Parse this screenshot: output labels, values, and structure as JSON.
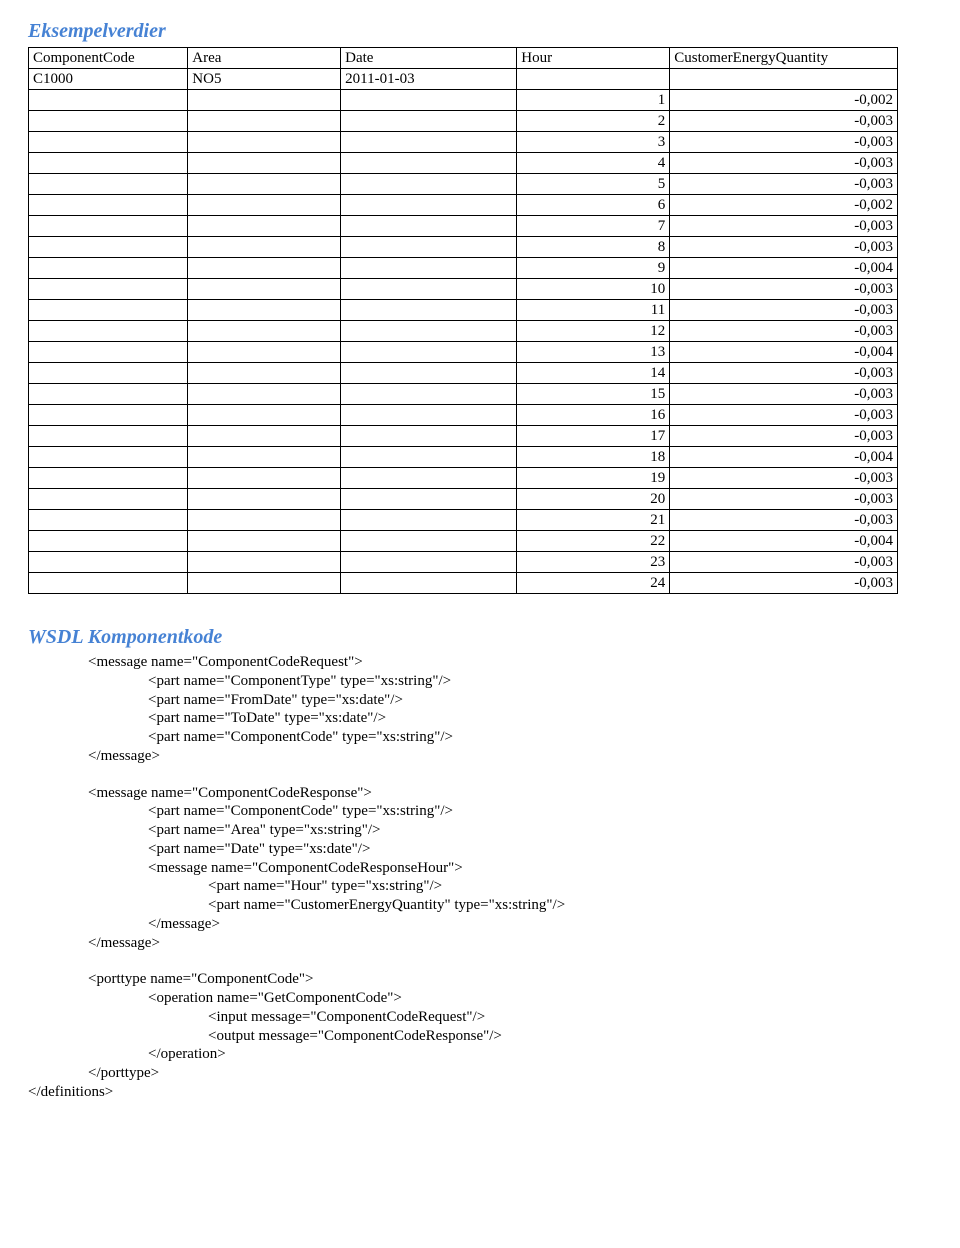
{
  "heading1": "Eksempelverdier",
  "table": {
    "headers": [
      "ComponentCode",
      "Area",
      "Date",
      "Hour",
      "CustomerEnergyQuantity"
    ],
    "first_row": {
      "code": "C1000",
      "area": "NO5",
      "date": "2011-01-03",
      "hour": "",
      "qty": ""
    },
    "rows": [
      {
        "hour": "1",
        "qty": "-0,002"
      },
      {
        "hour": "2",
        "qty": "-0,003"
      },
      {
        "hour": "3",
        "qty": "-0,003"
      },
      {
        "hour": "4",
        "qty": "-0,003"
      },
      {
        "hour": "5",
        "qty": "-0,003"
      },
      {
        "hour": "6",
        "qty": "-0,002"
      },
      {
        "hour": "7",
        "qty": "-0,003"
      },
      {
        "hour": "8",
        "qty": "-0,003"
      },
      {
        "hour": "9",
        "qty": "-0,004"
      },
      {
        "hour": "10",
        "qty": "-0,003"
      },
      {
        "hour": "11",
        "qty": "-0,003"
      },
      {
        "hour": "12",
        "qty": "-0,003"
      },
      {
        "hour": "13",
        "qty": "-0,004"
      },
      {
        "hour": "14",
        "qty": "-0,003"
      },
      {
        "hour": "15",
        "qty": "-0,003"
      },
      {
        "hour": "16",
        "qty": "-0,003"
      },
      {
        "hour": "17",
        "qty": "-0,003"
      },
      {
        "hour": "18",
        "qty": "-0,004"
      },
      {
        "hour": "19",
        "qty": "-0,003"
      },
      {
        "hour": "20",
        "qty": "-0,003"
      },
      {
        "hour": "21",
        "qty": "-0,003"
      },
      {
        "hour": "22",
        "qty": "-0,004"
      },
      {
        "hour": "23",
        "qty": "-0,003"
      },
      {
        "hour": "24",
        "qty": "-0,003"
      }
    ]
  },
  "heading2": "WSDL Komponentkode",
  "wsdl": [
    {
      "indent": 1,
      "text": "<message name=\"ComponentCodeRequest\">"
    },
    {
      "indent": 2,
      "text": "<part name=\"ComponentType\" type=\"xs:string\"/>"
    },
    {
      "indent": 2,
      "text": "<part name=\"FromDate\" type=\"xs:date\"/>"
    },
    {
      "indent": 2,
      "text": "<part name=\"ToDate\" type=\"xs:date\"/>"
    },
    {
      "indent": 2,
      "text": "<part name=\"ComponentCode\" type=\"xs:string\"/>"
    },
    {
      "indent": 1,
      "text": "</message>"
    },
    {
      "indent": 0,
      "text": ""
    },
    {
      "indent": 1,
      "text": "<message name=\"ComponentCodeResponse\">"
    },
    {
      "indent": 2,
      "text": "<part name=\"ComponentCode\" type=\"xs:string\"/>"
    },
    {
      "indent": 2,
      "text": "<part name=\"Area\" type=\"xs:string\"/>"
    },
    {
      "indent": 2,
      "text": "<part name=\"Date\" type=\"xs:date\"/>"
    },
    {
      "indent": 2,
      "text": "<message name=\"ComponentCodeResponseHour\">"
    },
    {
      "indent": 3,
      "text": "<part name=\"Hour\" type=\"xs:string\"/>"
    },
    {
      "indent": 3,
      "text": "<part name=\"CustomerEnergyQuantity\" type=\"xs:string\"/>"
    },
    {
      "indent": 2,
      "text": "</message>"
    },
    {
      "indent": 1,
      "text": "</message>"
    },
    {
      "indent": 0,
      "text": ""
    },
    {
      "indent": 1,
      "text": "<porttype name=\"ComponentCode\">"
    },
    {
      "indent": 2,
      "text": "<operation name=\"GetComponentCode\">"
    },
    {
      "indent": 3,
      "text": "<input message=\"ComponentCodeRequest\"/>"
    },
    {
      "indent": 3,
      "text": "<output message=\"ComponentCodeResponse\"/>"
    },
    {
      "indent": 2,
      "text": "</operation>"
    },
    {
      "indent": 1,
      "text": "</porttype>"
    },
    {
      "indent": 0,
      "text": "</definitions>"
    }
  ]
}
